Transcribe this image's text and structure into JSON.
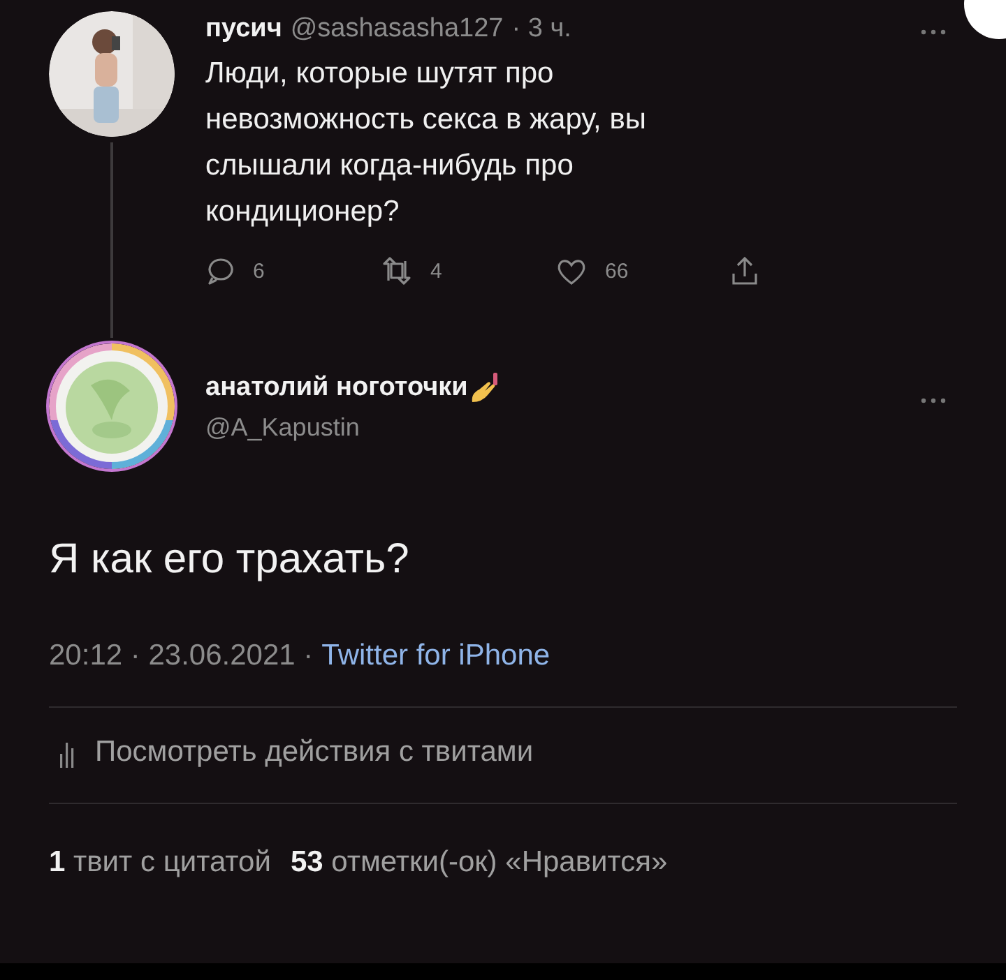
{
  "parent_tweet": {
    "name": "пусич",
    "handle": "@sashasasha127",
    "time": "· 3 ч.",
    "text": "Люди, которые шутят про невозможность секса в жару, вы слышали когда-нибудь про кондиционер?",
    "actions": [
      {
        "kind": "reply",
        "count": "6"
      },
      {
        "kind": "retweet",
        "count": "4"
      },
      {
        "kind": "like",
        "count": "66"
      },
      {
        "kind": "share"
      }
    ]
  },
  "main_tweet": {
    "name": "анатолий ноготочки",
    "handle": "@A_Kapustin",
    "text": "Я как его трахать?",
    "timestamp": "20:12 · 23.06.2021 ·",
    "source": "Twitter for iPhone"
  },
  "activity_link": "Посмотреть действия с твитами",
  "stats": [
    {
      "text": "**1** твит с цитатой"
    },
    {
      "text": "**53** отметки(-ок) «Нравится»"
    }
  ]
}
